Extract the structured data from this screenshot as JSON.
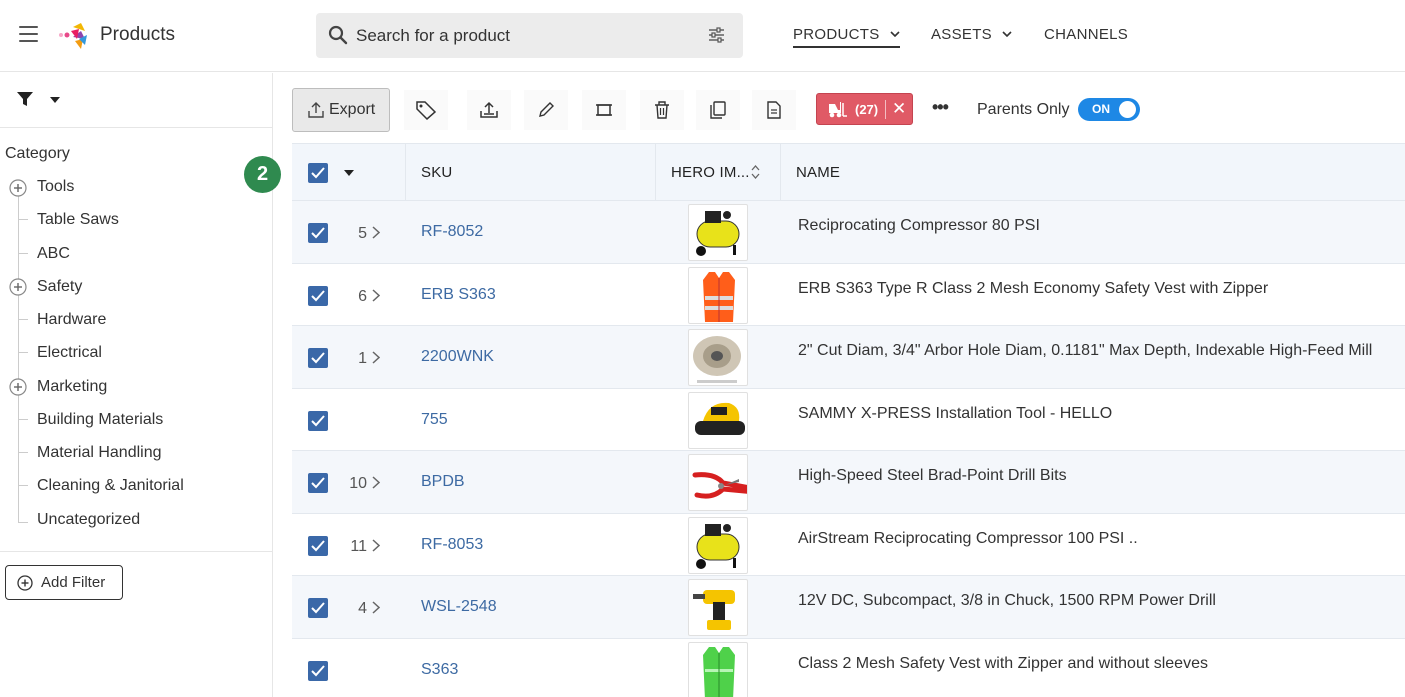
{
  "header": {
    "app_title": "Products",
    "search_placeholder": "Search for a product",
    "nav": [
      {
        "label": "PRODUCTS",
        "has_dropdown": true,
        "active": true
      },
      {
        "label": "ASSETS",
        "has_dropdown": true,
        "active": false
      },
      {
        "label": "CHANNELS",
        "has_dropdown": false,
        "active": false
      }
    ]
  },
  "sidebar": {
    "category_title": "Category",
    "categories": [
      {
        "label": "Tools",
        "expandable": true
      },
      {
        "label": "Table Saws",
        "expandable": false
      },
      {
        "label": "ABC",
        "expandable": false
      },
      {
        "label": "Safety",
        "expandable": true
      },
      {
        "label": "Hardware",
        "expandable": false
      },
      {
        "label": "Electrical",
        "expandable": false
      },
      {
        "label": "Marketing",
        "expandable": true
      },
      {
        "label": "Building Materials",
        "expandable": false
      },
      {
        "label": "Material Handling",
        "expandable": false
      },
      {
        "label": "Cleaning & Janitorial",
        "expandable": false
      },
      {
        "label": "Uncategorized",
        "expandable": false
      }
    ],
    "add_filter_label": "Add Filter",
    "step_badge": "2"
  },
  "toolbar": {
    "export_label": "Export",
    "selection_chip_count": "(27)",
    "parents_only_label": "Parents Only",
    "toggle_label": "ON",
    "toggle_on": true,
    "chip_color": "#e05a66",
    "toggle_color": "#1e88e5"
  },
  "table": {
    "columns": [
      "SKU",
      "HERO IM...",
      "NAME"
    ],
    "rows": [
      {
        "count": "5",
        "sku": "RF-8052",
        "image": "air-compressor-yellow",
        "name": "Reciprocating Compressor 80 PSI"
      },
      {
        "count": "6",
        "sku": "ERB S363",
        "image": "orange-safety-vest",
        "name": "ERB S363 Type R Class 2 Mesh Economy Safety Vest with Zipper"
      },
      {
        "count": "1",
        "sku": "2200WNK",
        "image": "indexable-mill",
        "name": "2\" Cut Diam, 3/4\" Arbor Hole Diam, 0.1181\" Max Depth, Indexable High-Feed Mill"
      },
      {
        "count": "",
        "sku": "755",
        "image": "orbital-sander",
        "name": "SAMMY X-PRESS Installation Tool - HELLO"
      },
      {
        "count": "10",
        "sku": "BPDB",
        "image": "red-pliers",
        "name": "High-Speed Steel Brad-Point Drill Bits"
      },
      {
        "count": "11",
        "sku": "RF-8053",
        "image": "air-compressor-yellow",
        "name": "AirStream Reciprocating Compressor 100 PSI .."
      },
      {
        "count": "4",
        "sku": "WSL-2548",
        "image": "cordless-drill",
        "name": "12V DC, Subcompact, 3/8 in Chuck, 1500 RPM Power Drill"
      },
      {
        "count": "",
        "sku": "S363",
        "image": "green-safety-vest",
        "name": "Class 2 Mesh Safety Vest with Zipper and without sleeves"
      }
    ]
  }
}
